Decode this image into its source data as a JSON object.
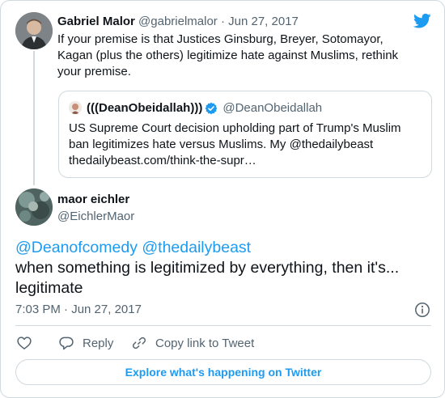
{
  "colors": {
    "accent": "#1d9bf0",
    "text": "#0f1419",
    "muted": "#536471",
    "border": "#cfd9de"
  },
  "parent_tweet": {
    "name": "Gabriel Malor",
    "handle": "@gabrielmalor",
    "separator": "·",
    "date": "Jun 27, 2017",
    "text": "If your premise is that Justices Ginsburg, Breyer, Sotomayor, Kagan (plus the others) legitimize hate against Muslims, rethink your premise."
  },
  "quoted_tweet": {
    "name": "(((DeanObeidallah)))",
    "handle": "@DeanObeidallah",
    "text": "US Supreme Court decision upholding part of Trump's Muslim ban legitimizes hate versus Muslims. My @thedailybeast thedailybeast.com/think-the-supr…"
  },
  "main_tweet": {
    "name": "maor eichler",
    "handle": "@EichlerMaor",
    "mentions": "@Deanofcomedy @thedailybeast",
    "text": "when something is legitimized by everything, then it's... legitimate",
    "timestamp": "7:03 PM · Jun 27, 2017"
  },
  "actions": {
    "like_icon": "heart-icon",
    "reply_label": "Reply",
    "copy_label": "Copy link to Tweet"
  },
  "explore_label": "Explore what's happening on Twitter",
  "icons": [
    "twitter-bird-icon",
    "verified-badge-icon",
    "info-icon",
    "heart-icon",
    "reply-icon",
    "link-icon"
  ]
}
